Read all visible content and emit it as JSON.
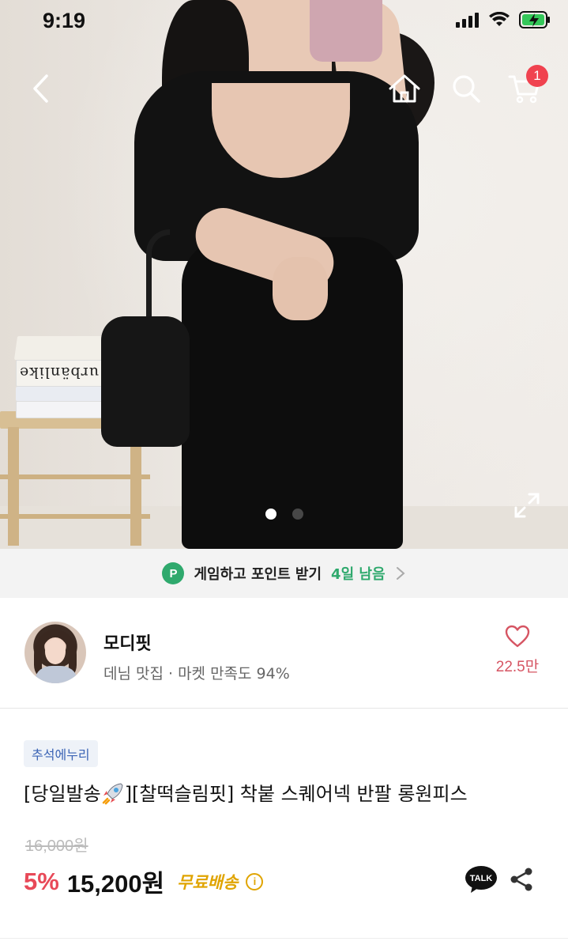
{
  "status_bar": {
    "time": "9:19"
  },
  "nav": {
    "back_icon": "chevron-left-icon",
    "home_icon": "home-icon",
    "search_icon": "search-icon",
    "cart_icon": "cart-icon",
    "cart_count": "1"
  },
  "gallery": {
    "book_label": "urbänlike",
    "current_page": 1,
    "total_pages": 2,
    "expand_icon": "expand-icon"
  },
  "points_banner": {
    "badge": "P",
    "text": "게임하고 포인트 받기",
    "days_left": "4일 남음"
  },
  "shop": {
    "name": "모디핏",
    "subtitle": "데님 맛집 · 마켓 만족도 94%",
    "like_count": "22.5만"
  },
  "product": {
    "tag": "추석에누리",
    "title_before_icon": "[당일발송",
    "title_after_icon": "][찰떡슬림핏] 착붙 스퀘어넥 반팔 롱원피스",
    "original_price": "16,000원",
    "discount": "5%",
    "price": "15,200원",
    "shipping": "무료배송",
    "info_glyph": "i",
    "talk_label": "TALK"
  },
  "colors": {
    "accent_red": "#e84958",
    "badge_red": "#f0424f",
    "points_green": "#2fa96d",
    "shipping_yellow": "#e0a400",
    "tag_blue": "#3b64b5"
  }
}
